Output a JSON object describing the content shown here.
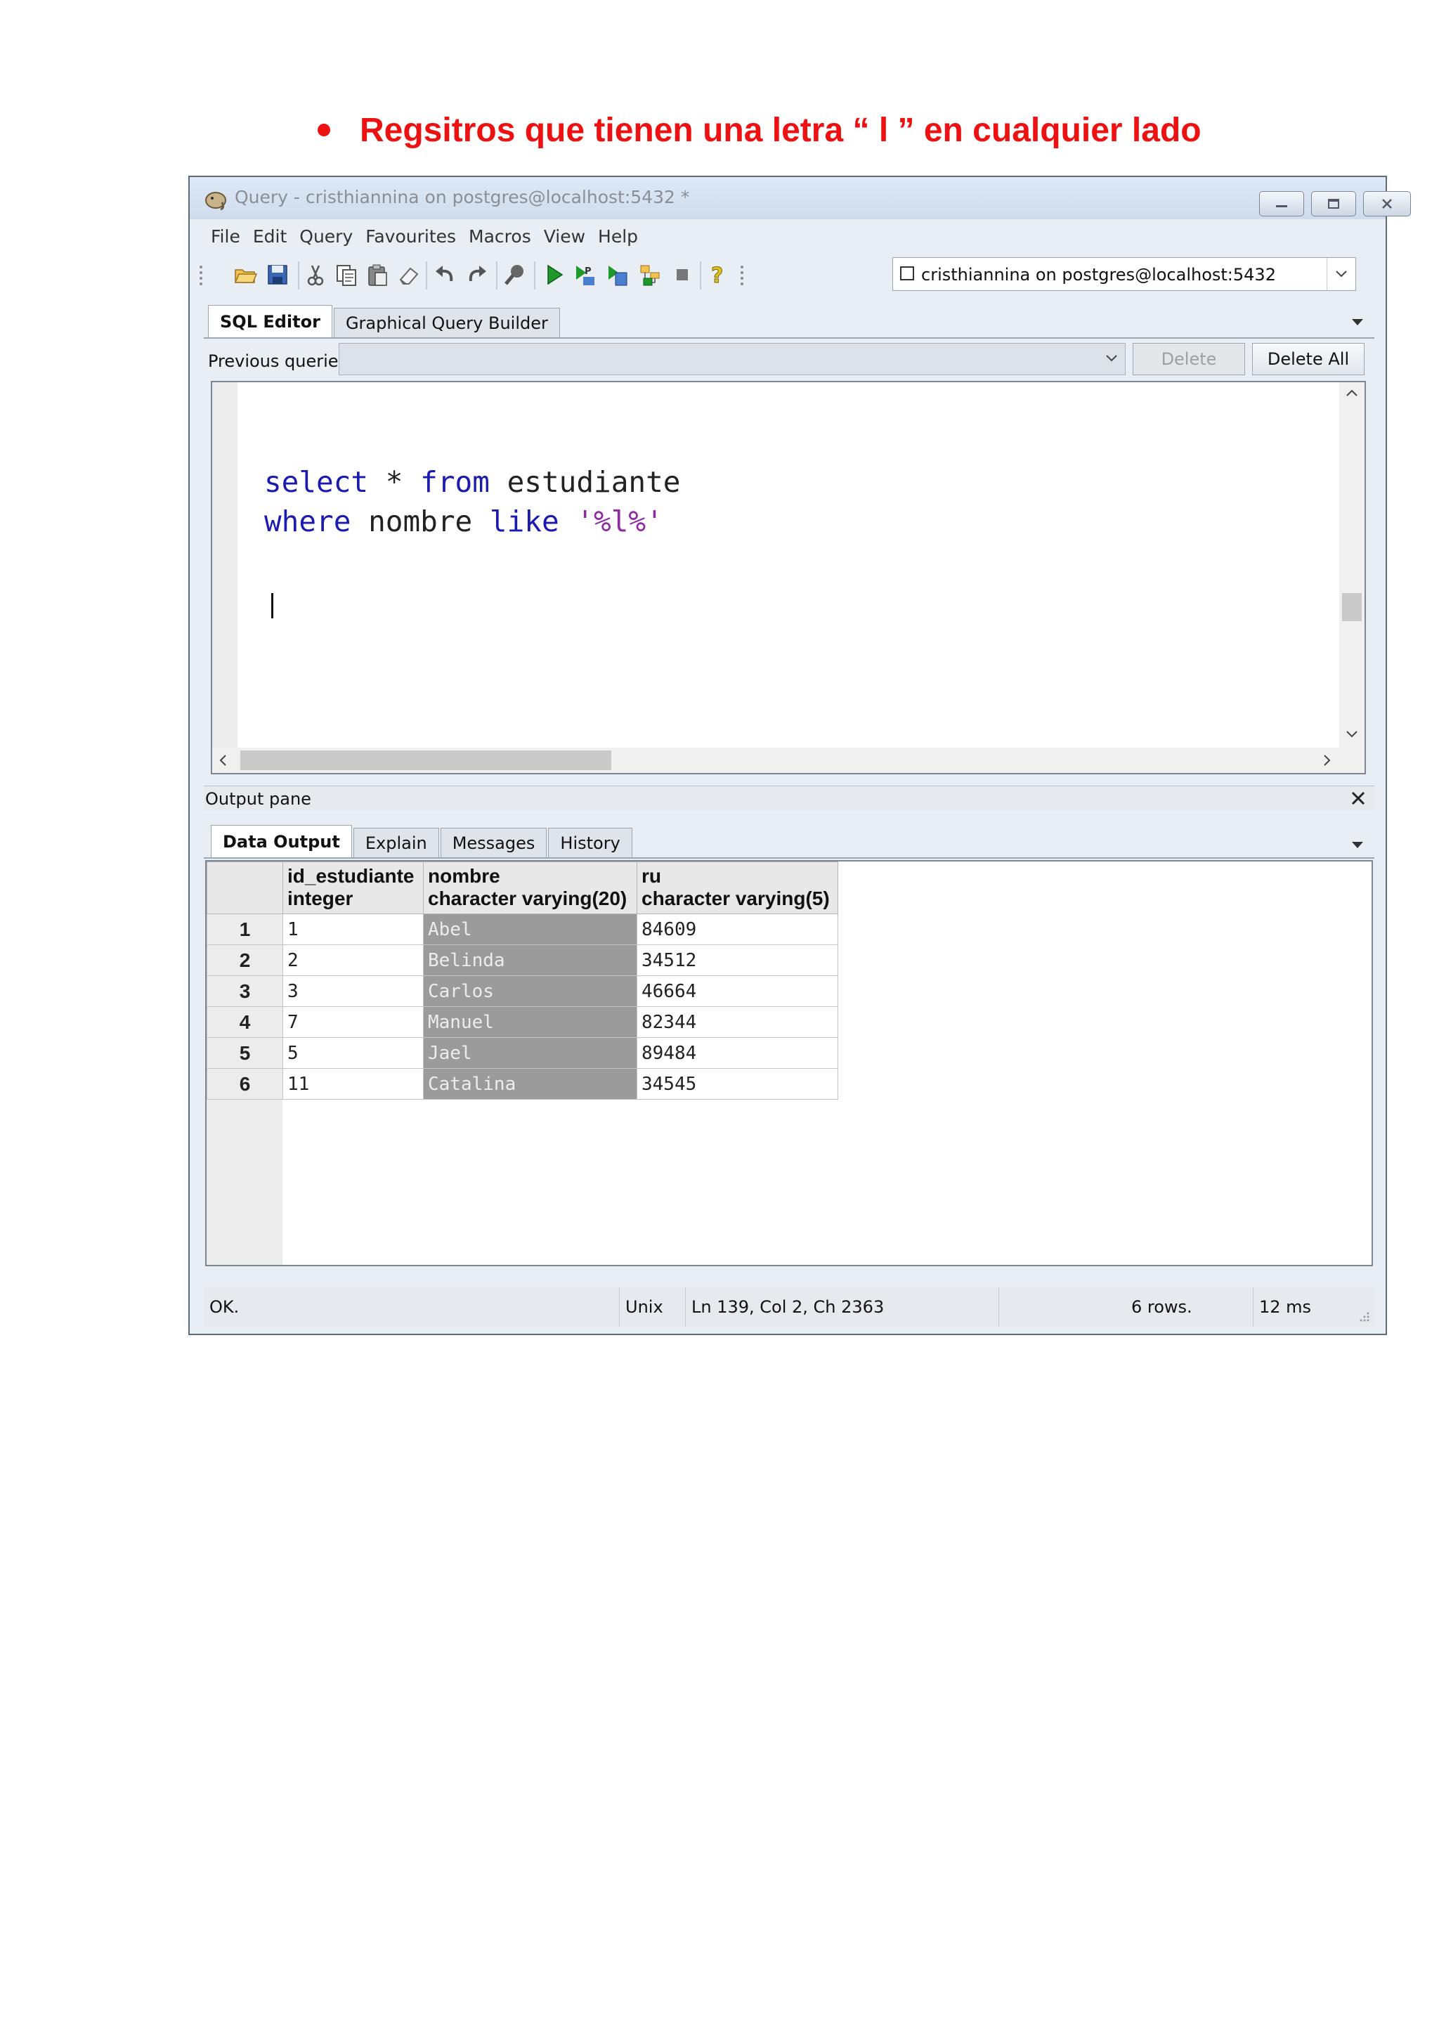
{
  "heading": "Regsitros que tienen una letra “ l ” en cualquier lado",
  "window": {
    "title": "Query - cristhiannina on postgres@localhost:5432 *",
    "controls": [
      "minimize",
      "restore",
      "close"
    ]
  },
  "menu": [
    "File",
    "Edit",
    "Query",
    "Favourites",
    "Macros",
    "View",
    "Help"
  ],
  "toolbar": {
    "icons": [
      "open-folder-icon",
      "save-icon",
      "cut-icon",
      "copy-icon",
      "paste-icon",
      "clear-icon",
      "undo-icon",
      "redo-icon",
      "find-icon",
      "execute-icon",
      "explain-icon",
      "execute-to-file-icon",
      "explain-analyze-icon",
      "stop-icon",
      "help-icon"
    ],
    "connection": "cristhiannina on postgres@localhost:5432"
  },
  "editor_tabs": [
    "SQL Editor",
    "Graphical Query Builder"
  ],
  "previous_queries": {
    "label": "Previous queries",
    "value": "",
    "delete_label": "Delete",
    "delete_all_label": "Delete All"
  },
  "sql": {
    "kw1": "select",
    "p1": " * ",
    "kw2": "from",
    "p2": " estudiante",
    "kw3": "where",
    "p3": " nombre ",
    "kw4": "like",
    "p4": " ",
    "str": "'%l%'"
  },
  "output_pane": {
    "label": "Output pane",
    "tabs": [
      "Data Output",
      "Explain",
      "Messages",
      "History"
    ]
  },
  "results": {
    "columns": [
      {
        "name": "id_estudiante",
        "type": "integer"
      },
      {
        "name": "nombre",
        "type": "character varying(20)"
      },
      {
        "name": "ru",
        "type": "character varying(5)"
      }
    ],
    "rows": [
      {
        "n": "1",
        "id": "1",
        "nombre": "Abel",
        "ru": "84609"
      },
      {
        "n": "2",
        "id": "2",
        "nombre": "Belinda",
        "ru": "34512"
      },
      {
        "n": "3",
        "id": "3",
        "nombre": "Carlos",
        "ru": "46664"
      },
      {
        "n": "4",
        "id": "7",
        "nombre": "Manuel",
        "ru": "82344"
      },
      {
        "n": "5",
        "id": "5",
        "nombre": "Jael",
        "ru": "89484"
      },
      {
        "n": "6",
        "id": "11",
        "nombre": "Catalina",
        "ru": "34545"
      }
    ]
  },
  "status": {
    "msg": "OK.",
    "eol": "Unix",
    "pos": "Ln 139, Col 2, Ch 2363",
    "rows": "6 rows.",
    "time": "12 ms"
  },
  "colors": {
    "heading": "#ee1111",
    "keyword": "#1b1bb0",
    "string": "#8f2aa4",
    "selected_column": "#9b9b9b"
  }
}
